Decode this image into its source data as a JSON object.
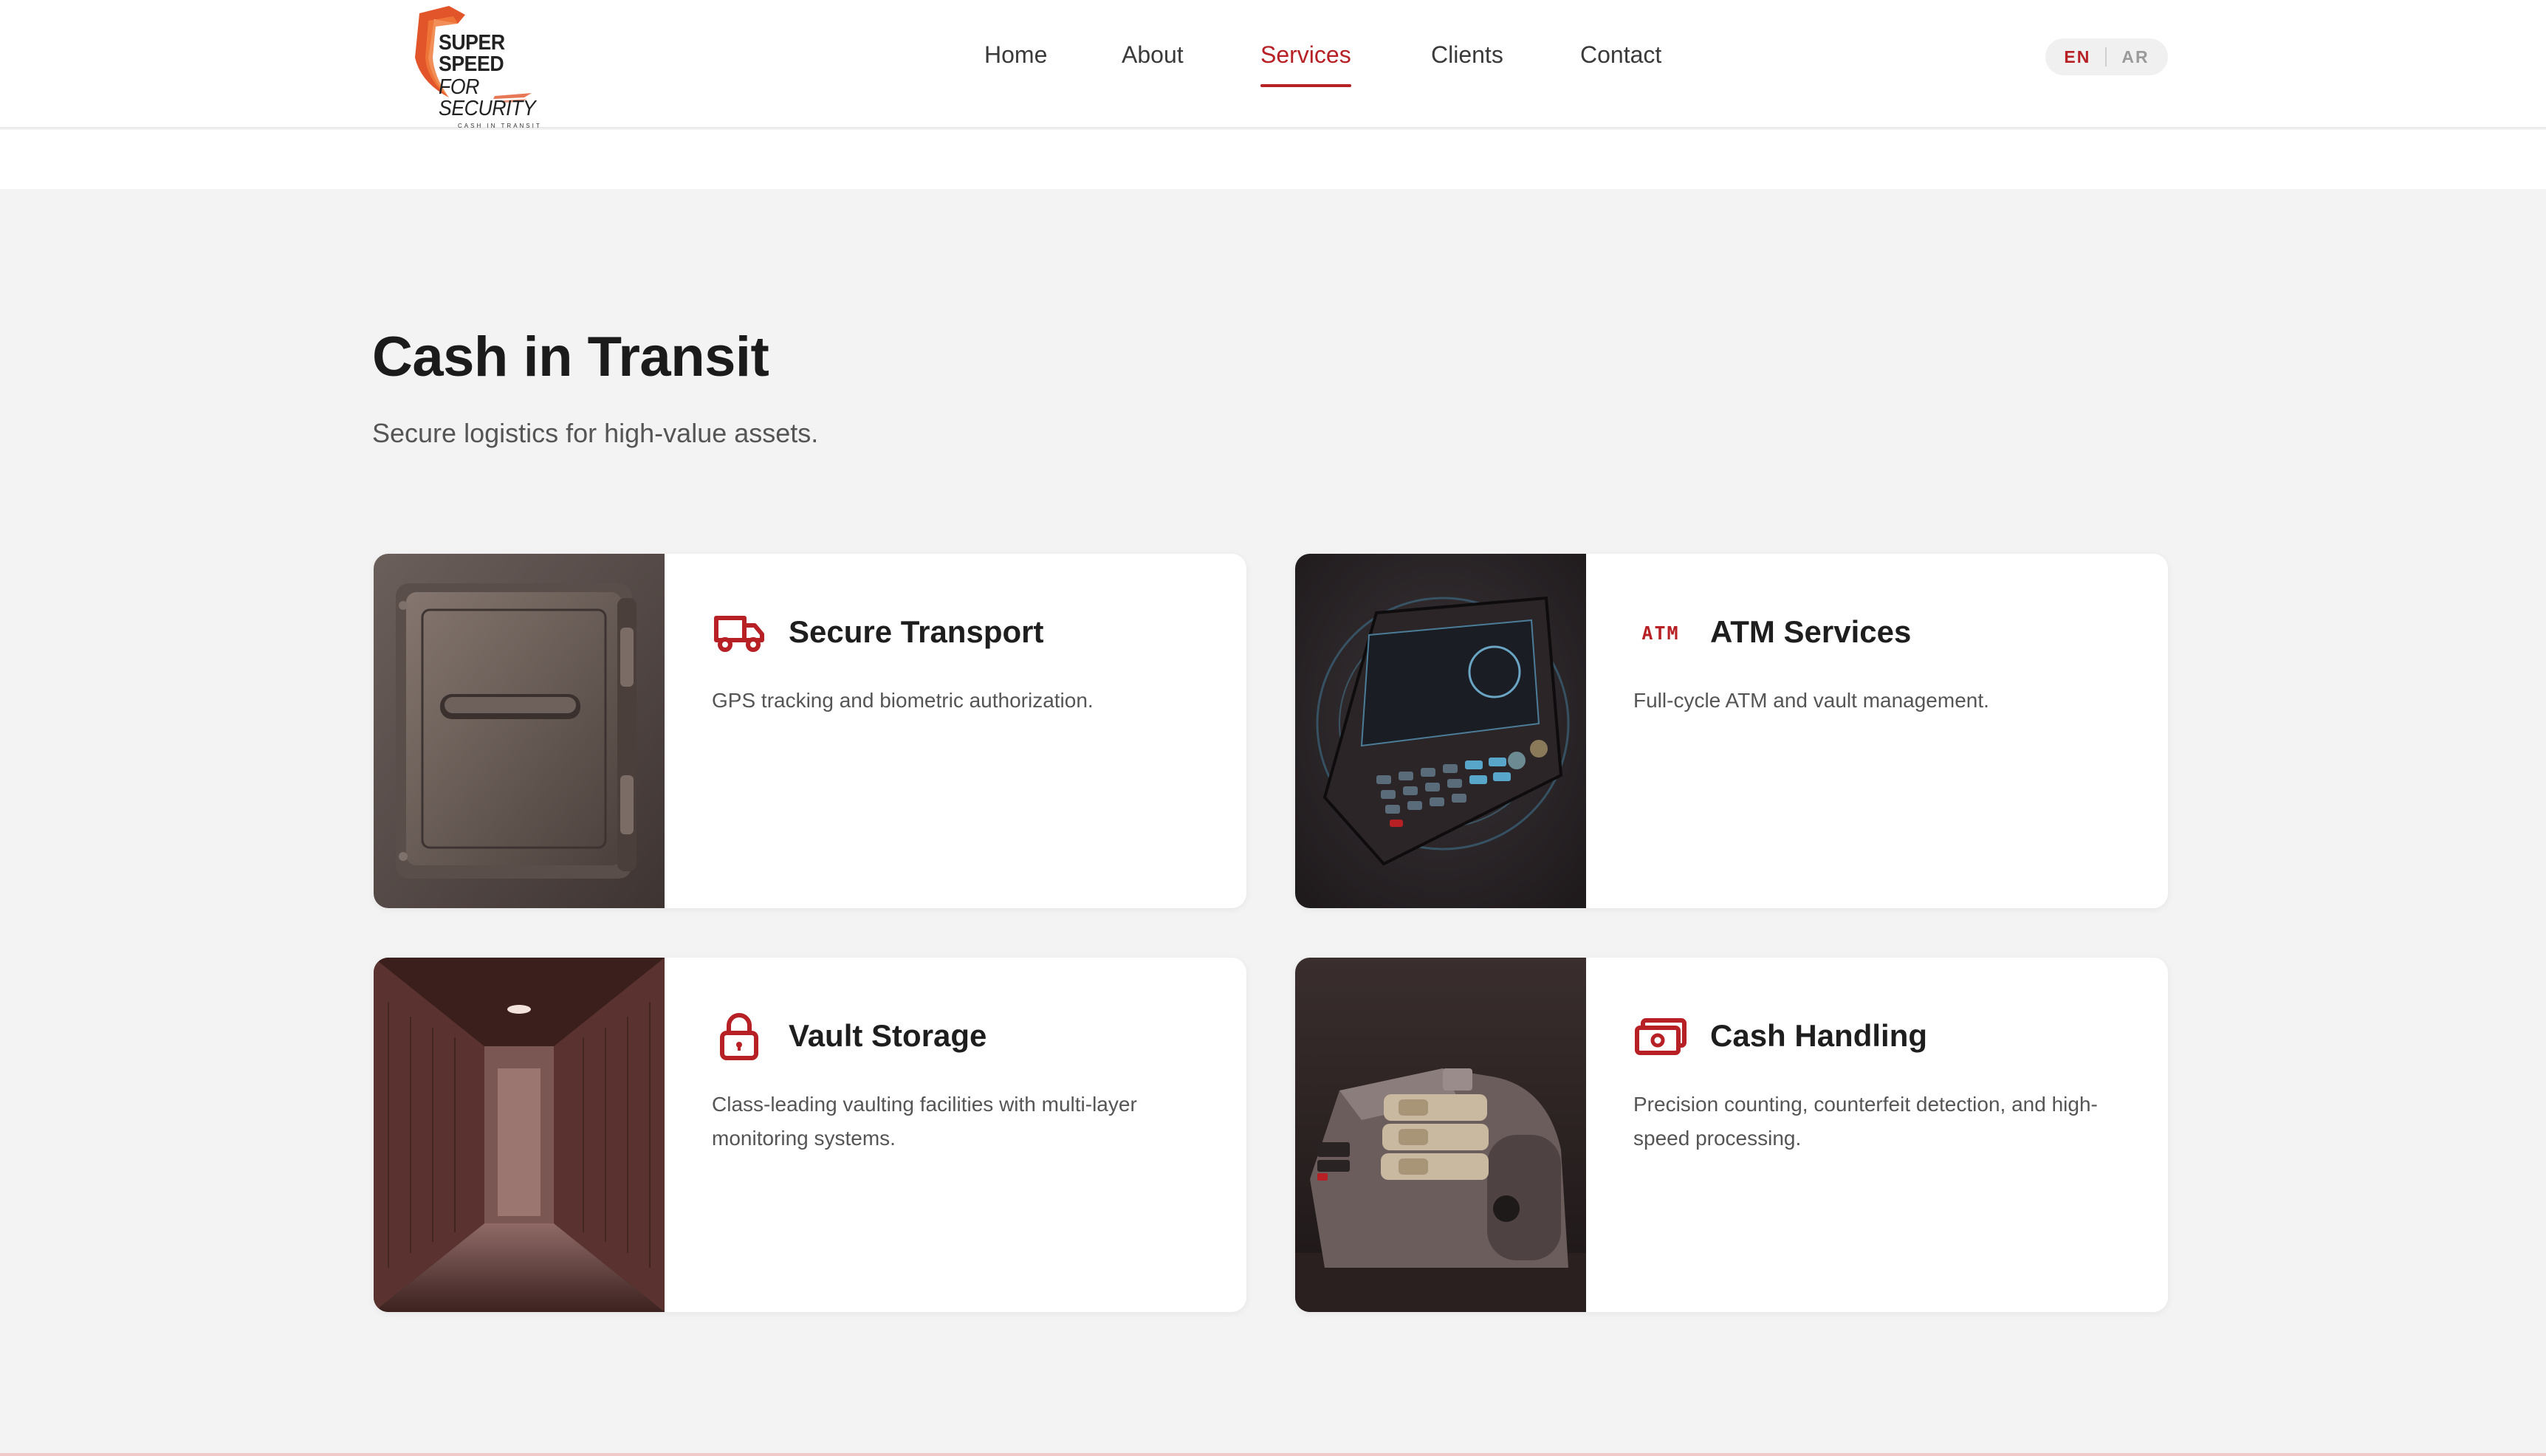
{
  "brand": {
    "logo_line1": "SUPER SPEED",
    "logo_line2": "FOR SECURITY",
    "logo_line3": "CASH IN TRANSIT",
    "accent": "#b72025"
  },
  "nav": {
    "items": [
      {
        "label": "Home",
        "active": false
      },
      {
        "label": "About",
        "active": false
      },
      {
        "label": "Services",
        "active": true
      },
      {
        "label": "Clients",
        "active": false
      },
      {
        "label": "Contact",
        "active": false
      }
    ]
  },
  "lang": {
    "en": "EN",
    "ar": "AR",
    "active": "EN"
  },
  "section": {
    "title": "Cash in Transit",
    "subtitle": "Secure logistics for high-value assets."
  },
  "cards": [
    {
      "title": "Secure Transport",
      "desc": "GPS tracking and biometric authorization.",
      "icon": "truck-icon",
      "image": "vault-door-image"
    },
    {
      "title": "ATM Services",
      "desc": "Full-cycle ATM and vault management.",
      "icon": "atm-icon",
      "icon_text": "ATM",
      "image": "atm-keypad-image"
    },
    {
      "title": "Vault Storage",
      "desc": "Class-leading vaulting facilities with multi-layer monitoring systems.",
      "icon": "lock-icon",
      "image": "vault-corridor-image"
    },
    {
      "title": "Cash Handling",
      "desc": "Precision counting, counterfeit detection, and high-speed processing.",
      "icon": "money-icon",
      "image": "money-counter-image"
    }
  ]
}
